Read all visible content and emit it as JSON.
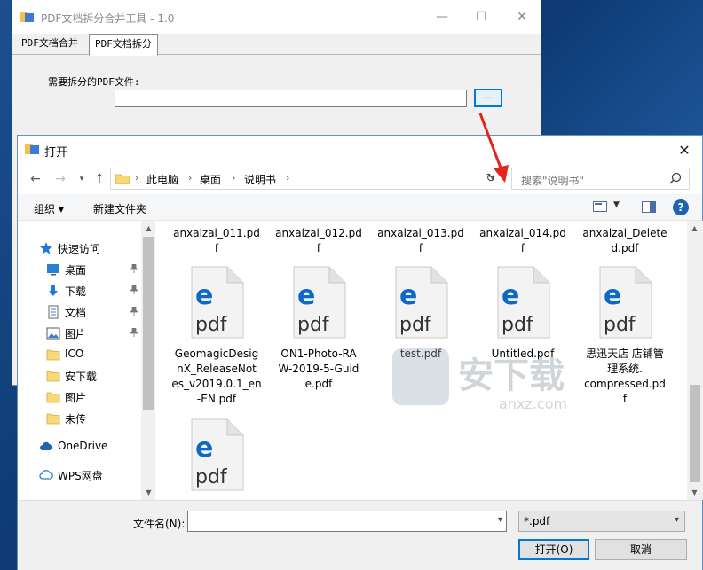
{
  "app": {
    "title": "PDF文档拆分合并工具 - 1.0",
    "tabs": [
      {
        "label": "PDF文档合并"
      },
      {
        "label": "PDF文档拆分"
      }
    ],
    "file_label": "需要拆分的PDF文件:",
    "browse_label": "..."
  },
  "dialog": {
    "title": "打开",
    "breadcrumb": [
      "此电脑",
      "桌面",
      "说明书"
    ],
    "search_placeholder": "搜索\"说明书\"",
    "toolbar": {
      "organize": "组织 ▾",
      "new_folder": "新建文件夹"
    },
    "sidebar": [
      {
        "label": "快速访问",
        "icon": "star-icon"
      },
      {
        "label": "桌面",
        "icon": "desktop-icon"
      },
      {
        "label": "下载",
        "icon": "download-icon"
      },
      {
        "label": "文档",
        "icon": "document-icon"
      },
      {
        "label": "图片",
        "icon": "picture-icon"
      },
      {
        "label": "ICO",
        "icon": "folder-icon"
      },
      {
        "label": "安下载",
        "icon": "folder-icon"
      },
      {
        "label": "图片",
        "icon": "folder-icon"
      },
      {
        "label": "未传",
        "icon": "folder-icon"
      },
      {
        "label": "OneDrive",
        "icon": "cloud-icon"
      },
      {
        "label": "WPS网盘",
        "icon": "cloud-icon"
      }
    ],
    "files_top": [
      {
        "line1": "anxaizai_011.pd",
        "line2": "f"
      },
      {
        "line1": "anxaizai_012.pd",
        "line2": "f"
      },
      {
        "line1": "anxaizai_013.pd",
        "line2": "f"
      },
      {
        "line1": "anxaizai_014.pd",
        "line2": "f"
      },
      {
        "line1": "anxaizai_Delete",
        "line2": "d.pdf"
      }
    ],
    "files_mid": [
      {
        "lines": [
          "GeomagicDesig",
          "nX_ReleaseNot",
          "es_v2019.0.1_en",
          "-EN.pdf"
        ]
      },
      {
        "lines": [
          "ON1-Photo-RA",
          "W-2019-5-Guid",
          "e.pdf"
        ]
      },
      {
        "lines": [
          "test.pdf"
        ]
      },
      {
        "lines": [
          "Untitled.pdf"
        ]
      },
      {
        "lines": [
          "思迅天店 店铺管",
          "理系统.",
          "compressed.pd",
          "f"
        ]
      }
    ],
    "pdf_icon_text": "pdf",
    "filename_label": "文件名(N):",
    "filename_value": "",
    "filter": "*.pdf",
    "open_button": "打开(O)",
    "cancel_button": "取消",
    "watermark": "安下载",
    "watermark_sub": "anxz.com"
  },
  "colors": {
    "accent": "#0078d7",
    "edge_blue": "#0c69c7",
    "arrow_red": "#e3241b",
    "folder_yellow": "#f8d775"
  }
}
